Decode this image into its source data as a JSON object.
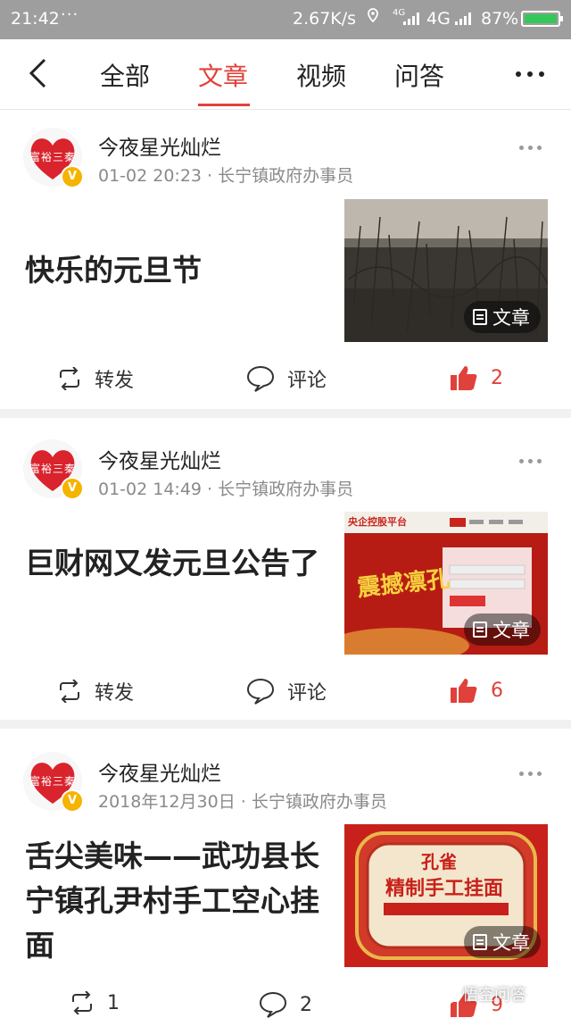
{
  "status_bar": {
    "time": "21:42",
    "dots": "···",
    "speed": "2.67K/s",
    "signal_small": "4G",
    "network": "4G",
    "battery": "87%",
    "battery_color": "#34c759"
  },
  "nav": {
    "tabs": [
      "全部",
      "文章",
      "视频",
      "问答"
    ],
    "active_tab": "文章",
    "accent_color": "#e0413b"
  },
  "posts": [
    {
      "author": "今夜星光灿烂",
      "avatar_text": "富裕三秦",
      "meta": "01-02 20:23 · 长宁镇政府办事员",
      "title": "快乐的元旦节",
      "thumb_tag": "文章",
      "repost_label": "转发",
      "comment_label": "评论",
      "likes": "2"
    },
    {
      "author": "今夜星光灿烂",
      "avatar_text": "富裕三秦",
      "meta": "01-02 14:49 · 长宁镇政府办事员",
      "title": "巨财网又发元旦公告了",
      "thumb_tag": "文章",
      "thumb_header": "央企控股平台",
      "thumb_big_text": "震撼凛孔",
      "repost_label": "转发",
      "comment_label": "评论",
      "likes": "6"
    },
    {
      "author": "今夜星光灿烂",
      "avatar_text": "富裕三秦",
      "meta": "2018年12月30日 · 长宁镇政府办事员",
      "title": "舌尖美味——武功县长宁镇孔尹村手工空心挂面",
      "thumb_tag": "文章",
      "thumb_brand": "孔雀",
      "thumb_big_text": "精制手工挂面",
      "repost_count": "1",
      "comment_count": "2",
      "likes": "9"
    }
  ],
  "watermark": "悟空问答"
}
